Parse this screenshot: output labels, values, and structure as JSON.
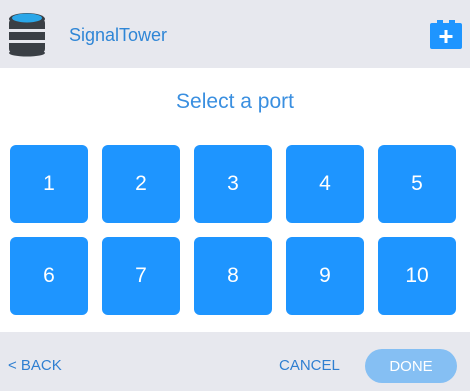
{
  "app": {
    "title": "SignalTower",
    "logo_icon": "database-icon",
    "add_icon": "add-battery-icon"
  },
  "main": {
    "title": "Select a port",
    "ports": [
      "1",
      "2",
      "3",
      "4",
      "5",
      "6",
      "7",
      "8",
      "9",
      "10"
    ]
  },
  "footer": {
    "back_label": "< BACK",
    "cancel_label": "CANCEL",
    "done_label": "DONE"
  },
  "colors": {
    "accent": "#1e95ff",
    "title_blue": "#3a8fe0",
    "done_disabled": "#85bff3",
    "background": "#e7e8ee"
  }
}
